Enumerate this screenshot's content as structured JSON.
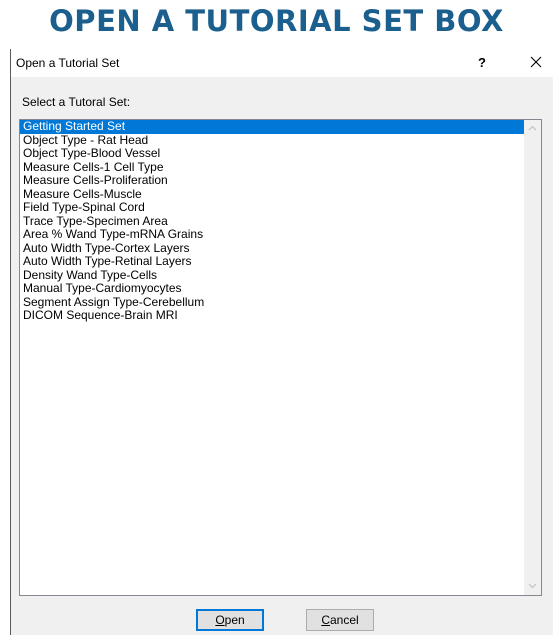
{
  "heading": "OPEN A TUTORIAL SET BOX",
  "dialog": {
    "title": "Open a Tutorial Set",
    "help_label": "?",
    "prompt": "Select a Tutoral Set:",
    "selected_index": 0,
    "items": [
      "Getting Started Set",
      "Object Type - Rat Head",
      "Object Type-Blood Vessel",
      "Measure Cells-1 Cell Type",
      "Measure Cells-Proliferation",
      "Measure Cells-Muscle",
      "Field Type-Spinal Cord",
      "Trace Type-Specimen Area",
      "Area % Wand Type-mRNA Grains",
      "Auto Width Type-Cortex Layers",
      "Auto Width Type-Retinal Layers",
      "Density Wand Type-Cells",
      "Manual Type-Cardiomyocytes",
      "Segment Assign Type-Cerebellum",
      "DICOM Sequence-Brain MRI"
    ],
    "buttons": {
      "open_accel": "O",
      "open_rest": "pen",
      "cancel_accel": "C",
      "cancel_rest": "ancel"
    }
  },
  "colors": {
    "heading": "#1b5f8e",
    "selection": "#0078d7",
    "dialog_bg": "#f0f0f0"
  },
  "icons": {
    "close": "close-icon",
    "scroll_up": "chevron-up-icon",
    "scroll_down": "chevron-down-icon"
  }
}
